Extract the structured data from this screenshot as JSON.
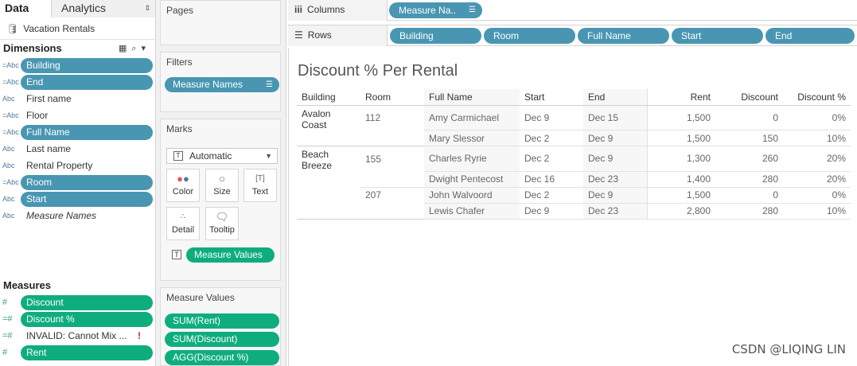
{
  "tabs": {
    "data": "Data",
    "analytics": "Analytics"
  },
  "datasource": "Vacation Rentals",
  "dimensions": {
    "title": "Dimensions",
    "fields": [
      {
        "type": "=Abc",
        "name": "Building",
        "style": "blue"
      },
      {
        "type": "=Abc",
        "name": "End",
        "style": "blue"
      },
      {
        "type": "Abc",
        "name": "First name",
        "style": "plain"
      },
      {
        "type": "=Abc",
        "name": "Floor",
        "style": "plain"
      },
      {
        "type": "=Abc",
        "name": "Full Name",
        "style": "blue"
      },
      {
        "type": "Abc",
        "name": "Last name",
        "style": "plain"
      },
      {
        "type": "Abc",
        "name": "Rental Property",
        "style": "plain"
      },
      {
        "type": "=Abc",
        "name": "Room",
        "style": "blue"
      },
      {
        "type": "Abc",
        "name": "Start",
        "style": "blue"
      },
      {
        "type": "Abc",
        "name": "Measure Names",
        "style": "italic"
      }
    ]
  },
  "measures": {
    "title": "Measures",
    "fields": [
      {
        "type": "#",
        "name": "Discount",
        "style": "green"
      },
      {
        "type": "=#",
        "name": "Discount %",
        "style": "green"
      },
      {
        "type": "=#",
        "name": "INVALID: Cannot Mix ...",
        "style": "plain",
        "warn": "!"
      },
      {
        "type": "#",
        "name": "Rent",
        "style": "green"
      }
    ]
  },
  "cards": {
    "pages": "Pages",
    "filters": "Filters",
    "filter_pill": "Measure Names",
    "marks": "Marks",
    "mark_type": "Automatic",
    "mark_buttons": {
      "color": "Color",
      "size": "Size",
      "text": "Text",
      "detail": "Detail",
      "tooltip": "Tooltip"
    },
    "marks_pill": "Measure Values",
    "measure_values": "Measure Values",
    "mv_pills": [
      "SUM(Rent)",
      "SUM(Discount)",
      "AGG(Discount %)"
    ]
  },
  "shelves": {
    "columns_label": "Columns",
    "columns_pill": "Measure Na..",
    "rows_label": "Rows",
    "rows_pills": [
      "Building",
      "Room",
      "Full Name",
      "Start",
      "End"
    ]
  },
  "view": {
    "title": "Discount % Per Rental",
    "headers": [
      "Building",
      "Room",
      "Full Name",
      "Start",
      "End",
      "Rent",
      "Discount",
      "Discount %"
    ],
    "rows": [
      {
        "building": "Avalon Coast",
        "room": "112",
        "name": "Amy Carmichael",
        "start": "Dec 9",
        "end": "Dec 15",
        "rent": "1,500",
        "discount": "0",
        "pct": "0%"
      },
      {
        "building": "",
        "room": "",
        "name": "Mary Slessor",
        "start": "Dec 2",
        "end": "Dec 9",
        "rent": "1,500",
        "discount": "150",
        "pct": "10%"
      },
      {
        "building": "Beach Breeze",
        "room": "155",
        "name": "Charles Ryrie",
        "start": "Dec 2",
        "end": "Dec 9",
        "rent": "1,300",
        "discount": "260",
        "pct": "20%"
      },
      {
        "building": "",
        "room": "",
        "name": "Dwight Pentecost",
        "start": "Dec 16",
        "end": "Dec 23",
        "rent": "1,400",
        "discount": "280",
        "pct": "20%"
      },
      {
        "building": "",
        "room": "207",
        "name": "John Walvoord",
        "start": "Dec 2",
        "end": "Dec 9",
        "rent": "1,500",
        "discount": "0",
        "pct": "0%"
      },
      {
        "building": "",
        "room": "",
        "name": "Lewis Chafer",
        "start": "Dec 9",
        "end": "Dec 23",
        "rent": "2,800",
        "discount": "280",
        "pct": "10%"
      }
    ]
  },
  "watermark": "CSDN @LIQING LIN",
  "colors": {
    "dimension_pill": "#4996b2",
    "measure_pill": "#0fad7e",
    "warning": "#d0212a"
  }
}
